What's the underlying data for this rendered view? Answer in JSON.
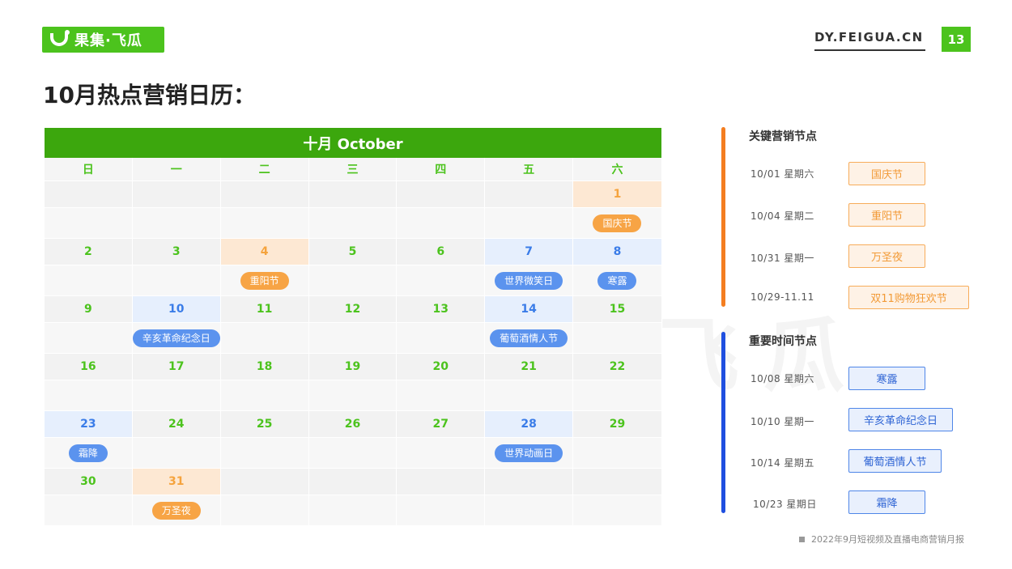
{
  "header": {
    "logo_text": "果集·飞瓜",
    "site": "DY.FEIGUA.CN",
    "page_number": "13",
    "brand_color": "#4cc31d"
  },
  "title": "10月热点营销日历：",
  "watermark": "果集·飞瓜",
  "calendar": {
    "header": "十月 October",
    "weekdays": [
      "日",
      "一",
      "二",
      "三",
      "四",
      "五",
      "六"
    ],
    "weeks": [
      {
        "days": [
          {
            "num": "",
            "event": ""
          },
          {
            "num": "",
            "event": ""
          },
          {
            "num": "",
            "event": ""
          },
          {
            "num": "",
            "event": ""
          },
          {
            "num": "",
            "event": ""
          },
          {
            "num": "",
            "event": ""
          },
          {
            "num": "1",
            "event": "国庆节",
            "style": "orange"
          }
        ]
      },
      {
        "days": [
          {
            "num": "2",
            "event": ""
          },
          {
            "num": "3",
            "event": ""
          },
          {
            "num": "4",
            "event": "重阳节",
            "style": "orange"
          },
          {
            "num": "5",
            "event": ""
          },
          {
            "num": "6",
            "event": ""
          },
          {
            "num": "7",
            "event": "世界微笑日",
            "style": "blue"
          },
          {
            "num": "8",
            "event": "寒露",
            "style": "blue"
          }
        ]
      },
      {
        "days": [
          {
            "num": "9",
            "event": ""
          },
          {
            "num": "10",
            "event": "辛亥革命纪念日",
            "style": "blue"
          },
          {
            "num": "11",
            "event": ""
          },
          {
            "num": "12",
            "event": ""
          },
          {
            "num": "13",
            "event": ""
          },
          {
            "num": "14",
            "event": "葡萄酒情人节",
            "style": "blue"
          },
          {
            "num": "15",
            "event": ""
          }
        ]
      },
      {
        "days": [
          {
            "num": "16",
            "event": ""
          },
          {
            "num": "17",
            "event": ""
          },
          {
            "num": "18",
            "event": ""
          },
          {
            "num": "19",
            "event": ""
          },
          {
            "num": "20",
            "event": ""
          },
          {
            "num": "21",
            "event": ""
          },
          {
            "num": "22",
            "event": ""
          }
        ]
      },
      {
        "days": [
          {
            "num": "23",
            "event": "霜降",
            "style": "blue"
          },
          {
            "num": "24",
            "event": ""
          },
          {
            "num": "25",
            "event": ""
          },
          {
            "num": "26",
            "event": ""
          },
          {
            "num": "27",
            "event": ""
          },
          {
            "num": "28",
            "event": "世界动画日",
            "style": "blue"
          },
          {
            "num": "29",
            "event": ""
          }
        ]
      },
      {
        "days": [
          {
            "num": "30",
            "event": ""
          },
          {
            "num": "31",
            "event": "万圣夜",
            "style": "orange"
          },
          {
            "num": "",
            "event": ""
          },
          {
            "num": "",
            "event": ""
          },
          {
            "num": "",
            "event": ""
          },
          {
            "num": "",
            "event": ""
          },
          {
            "num": "",
            "event": ""
          }
        ]
      }
    ]
  },
  "key_nodes": {
    "title": "关键营销节点",
    "items": [
      {
        "date": "10/01  星期六",
        "name": "国庆节"
      },
      {
        "date": "10/04  星期二",
        "name": "重阳节"
      },
      {
        "date": "10/31  星期一",
        "name": "万圣夜"
      },
      {
        "date": "10/29-11.11",
        "name": "双11购物狂欢节"
      }
    ]
  },
  "time_nodes": {
    "title": "重要时间节点",
    "items": [
      {
        "date": "10/08  星期六",
        "name": "寒露"
      },
      {
        "date": "10/10  星期一",
        "name": "辛亥革命纪念日"
      },
      {
        "date": "10/14  星期五",
        "name": "葡萄酒情人节"
      },
      {
        "date": "10/23  星期日",
        "name": "霜降"
      }
    ]
  },
  "footer": "2022年9月短视频及直播电商营销月报"
}
